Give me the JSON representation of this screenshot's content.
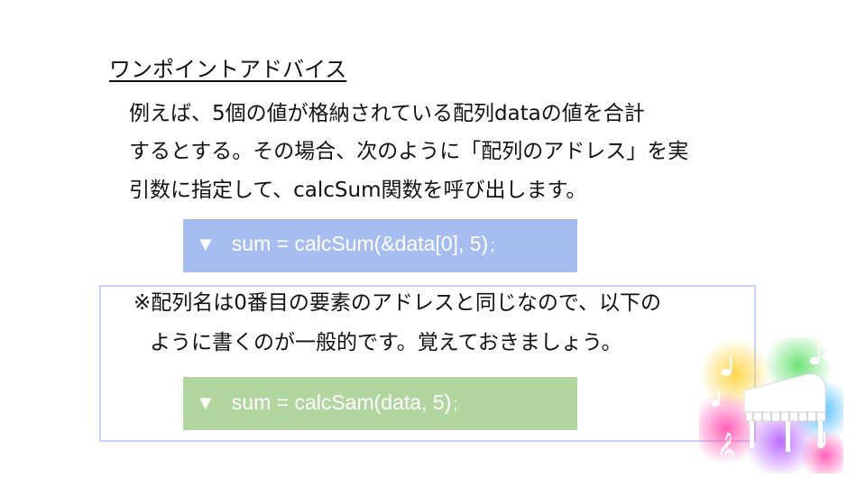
{
  "slide": {
    "heading": "ワンポイントアドバイス",
    "paragraph_lines": [
      "例えば、5個の値が格納されている配列dataの値を合計",
      "するとする。その場合、次のように「配列のアドレス」を実",
      "引数に指定して、calcSum関数を呼び出します。"
    ],
    "code1": {
      "marker": "▼",
      "text": "sum  = calcSum(&data[0], 5)",
      "semicolon": ";"
    },
    "note_lines": [
      "※配列名は0番目の要素のアドレスと同じなので、以下の",
      "ように書くのが一般的です。覚えておきましょう。"
    ],
    "code2": {
      "marker": "▼",
      "text": "sum = calcSam(data, 5)",
      "semicolon": ";"
    }
  },
  "colors": {
    "code1_background": "#a6bdf0",
    "code2_background": "#b1d6a0",
    "note_border": "#c7d3f4"
  },
  "icons": [
    "rainbow-piano-music-notes-illustration"
  ]
}
